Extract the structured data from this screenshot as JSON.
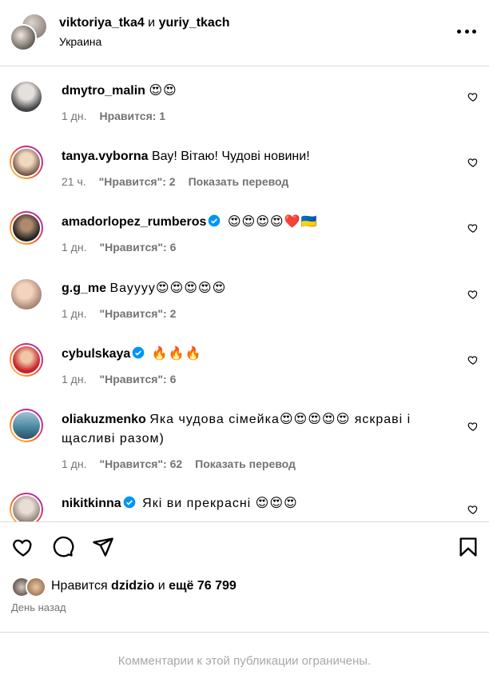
{
  "header": {
    "user1": "viktoriya_tka4",
    "conj": " и ",
    "user2": "yuriy_tkach",
    "location": "Украина"
  },
  "comments": [
    {
      "user": "dmytro_malin",
      "text": "😍😍",
      "verified": false,
      "time": "1 дн.",
      "likes": "Нравится: 1",
      "translate": ""
    },
    {
      "user": "tanya.vyborna",
      "text": "Вау! Вітаю! Чудові новини!",
      "verified": false,
      "time": "21 ч.",
      "likes": "\"Нравится\": 2",
      "translate": "Показать перевод"
    },
    {
      "user": "amadorlopez_rumberos",
      "text": "😍😍😍😍❤️🇺🇦",
      "verified": true,
      "time": "1 дн.",
      "likes": "\"Нравится\": 6",
      "translate": ""
    },
    {
      "user": "g.g_me",
      "text": "Вауууу😍😍😍😍😍",
      "verified": false,
      "time": "1 дн.",
      "likes": "\"Нравится\": 2",
      "translate": ""
    },
    {
      "user": "cybulskaya",
      "text": "🔥🔥🔥",
      "verified": true,
      "time": "1 дн.",
      "likes": "\"Нравится\": 6",
      "translate": ""
    },
    {
      "user": "oliakuzmenko",
      "text": "Яка чудова сімейка😍😍😍😍😍 яскраві і щасливі разом)",
      "verified": false,
      "time": "1 дн.",
      "likes": "\"Нравится\": 62",
      "translate": "Показать перевод"
    },
    {
      "user": "nikitkinna",
      "text": "Які ви прекрасні 😍😍😍",
      "verified": true,
      "time": "",
      "likes": "",
      "translate": ""
    }
  ],
  "likes_line": {
    "prefix": "Нравится ",
    "user": "dzidzio",
    "middle": " и ",
    "rest": "ещё 76 799"
  },
  "date": "День назад",
  "footer": "Комментарии к этой публикации ограничены.",
  "colors": {
    "muted": "#737373",
    "border": "#dbdbdb",
    "verified": "#0095f6"
  }
}
